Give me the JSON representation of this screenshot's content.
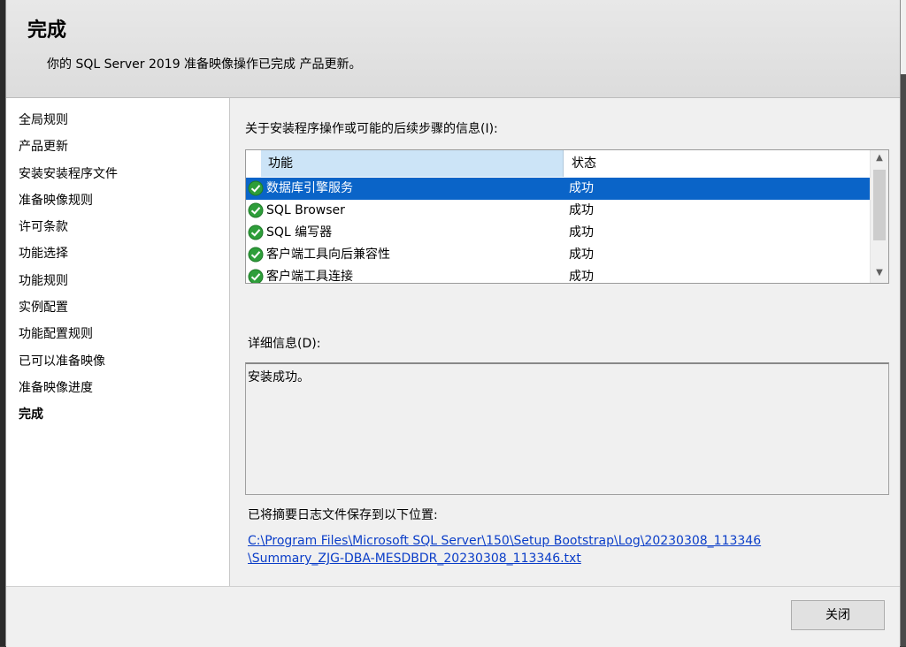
{
  "header": {
    "title": "完成",
    "subtitle": "你的 SQL Server 2019 准备映像操作已完成 产品更新。"
  },
  "sidebar": {
    "items": [
      {
        "label": "全局规则"
      },
      {
        "label": "产品更新"
      },
      {
        "label": "安装安装程序文件"
      },
      {
        "label": "准备映像规则"
      },
      {
        "label": "许可条款"
      },
      {
        "label": "功能选择"
      },
      {
        "label": "功能规则"
      },
      {
        "label": "实例配置"
      },
      {
        "label": "功能配置规则"
      },
      {
        "label": "已可以准备映像"
      },
      {
        "label": "准备映像进度"
      },
      {
        "label": "完成",
        "active": true
      }
    ]
  },
  "main": {
    "info_label": "关于安装程序操作或可能的后续步骤的信息(I):",
    "columns": {
      "feature": "功能",
      "status": "状态"
    },
    "rows": [
      {
        "feature": "数据库引擎服务",
        "status": "成功",
        "selected": true,
        "icon": "check-circle-icon"
      },
      {
        "feature": "SQL Browser",
        "status": "成功",
        "icon": "check-circle-icon"
      },
      {
        "feature": "SQL 编写器",
        "status": "成功",
        "icon": "check-circle-icon"
      },
      {
        "feature": "客户端工具向后兼容性",
        "status": "成功",
        "icon": "check-circle-icon"
      },
      {
        "feature": "客户端工具连接",
        "status": "成功",
        "icon": "check-circle-icon"
      }
    ],
    "details_label": "详细信息(D):",
    "details_text": "安装成功。",
    "log_label": "已将摘要日志文件保存到以下位置:",
    "log_link_line1": "C:\\Program Files\\Microsoft SQL Server\\150\\Setup Bootstrap\\Log\\20230308_113346",
    "log_link_line2": "\\Summary_ZJG-DBA-MESDBDR_20230308_113346.txt"
  },
  "footer": {
    "close_label": "关闭"
  },
  "colors": {
    "selection": "#0a64c8",
    "header_column": "#cce4f7",
    "link": "#0a3dc8",
    "success_icon": "#2e9e3a"
  }
}
